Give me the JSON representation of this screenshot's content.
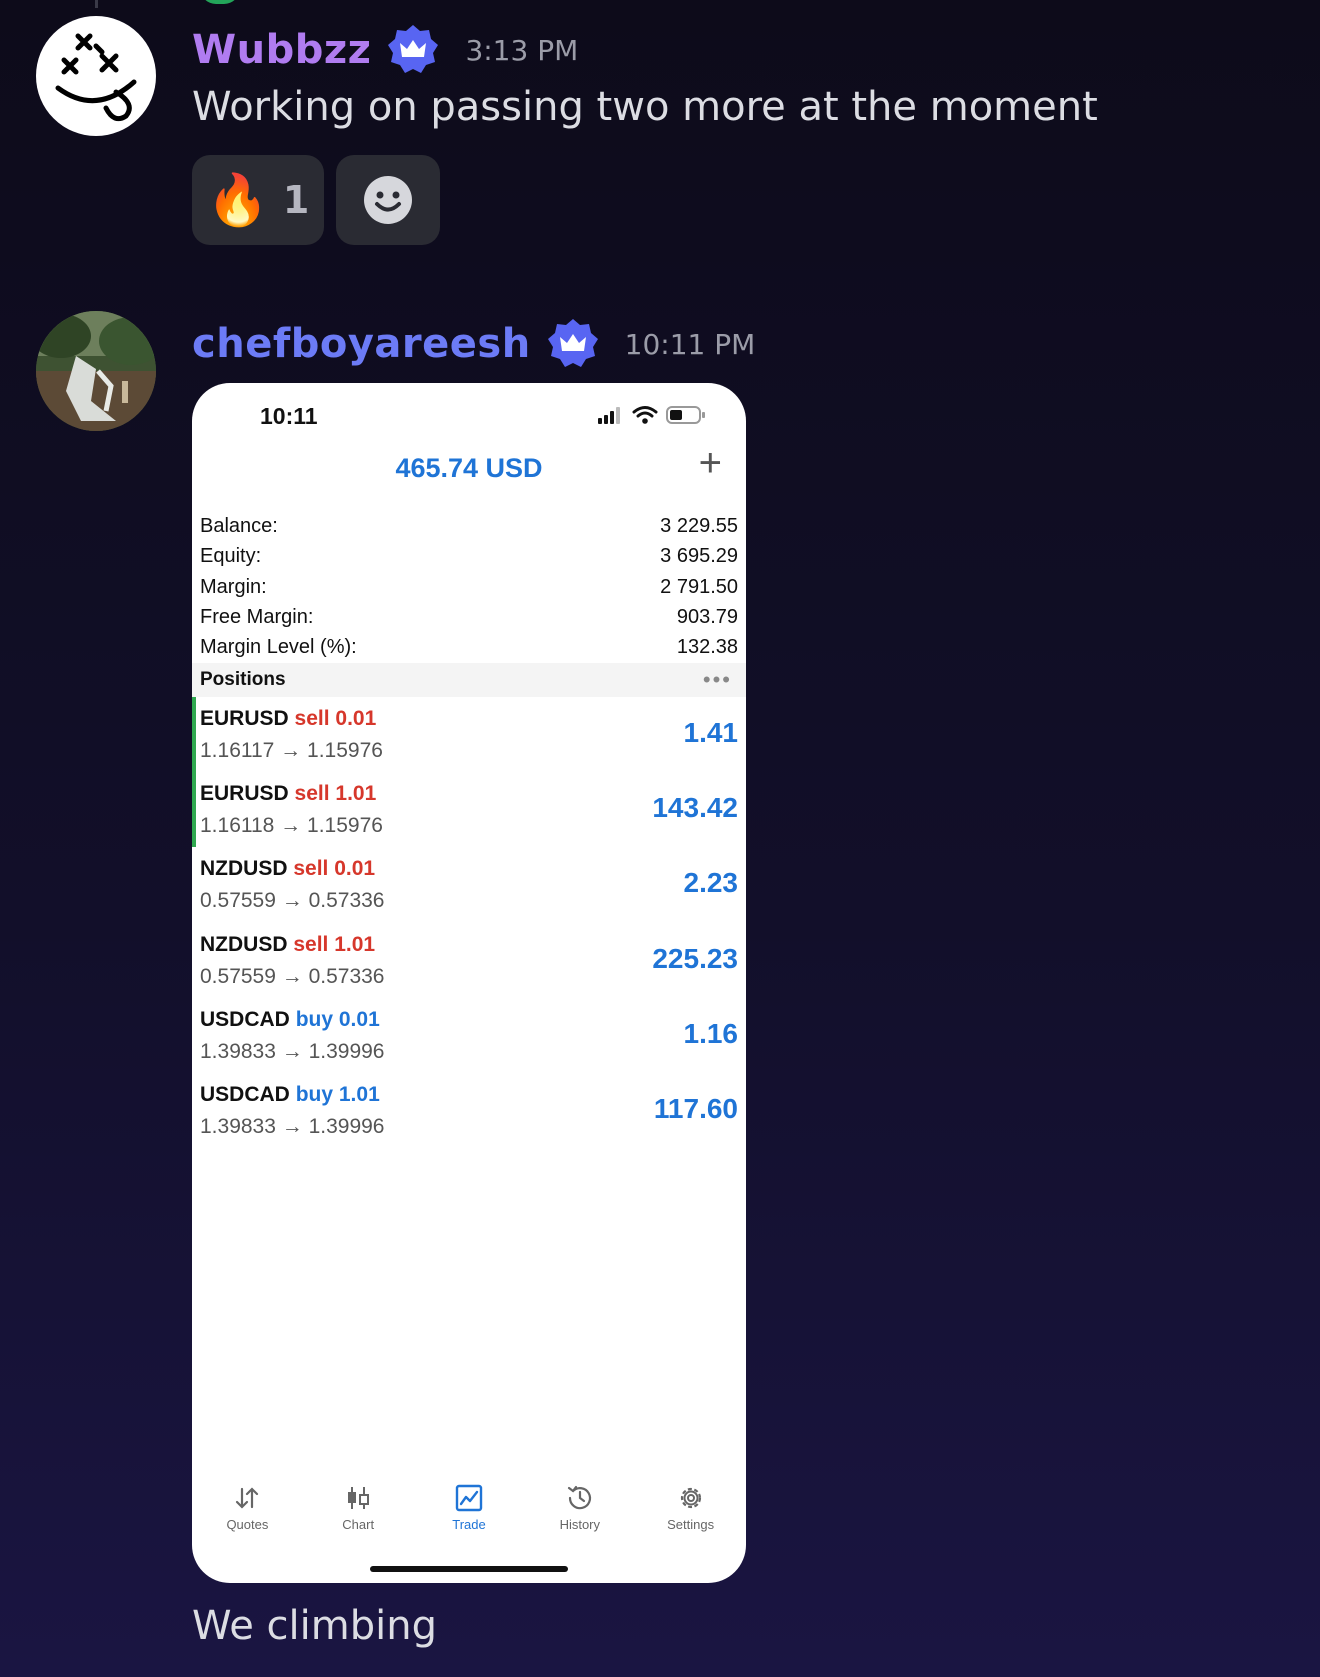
{
  "colors": {
    "wubbzz_name": "#b07cf0",
    "chef_name": "#6c7bf6",
    "badge": "#5865f2",
    "trade_blue": "#1f74d6",
    "sell_red": "#d6372b",
    "open_marker_green": "#2fa84f"
  },
  "messages": [
    {
      "username": "Wubbzz",
      "badge_icon": "nitro-crown-badge-icon",
      "timestamp": "3:13 PM",
      "text": "Working on passing two more at the moment",
      "reactions": [
        {
          "emoji": "🔥",
          "count": "1"
        }
      ]
    },
    {
      "username": "chefboyareesh",
      "badge_icon": "nitro-crown-badge-icon",
      "timestamp": "10:11 PM",
      "text": "We climbing"
    }
  ],
  "phone": {
    "status_time": "10:11",
    "header_value": "465.74 USD",
    "plus_label": "+",
    "summary": [
      {
        "label": "Balance:",
        "value": "3 229.55"
      },
      {
        "label": "Equity:",
        "value": "3 695.29"
      },
      {
        "label": "Margin:",
        "value": "2 791.50"
      },
      {
        "label": "Free Margin:",
        "value": "903.79"
      },
      {
        "label": "Margin Level (%):",
        "value": "132.38"
      }
    ],
    "positions_title": "Positions",
    "more_label": "•••",
    "positions": [
      {
        "symbol": "EURUSD",
        "side": "sell",
        "volume": "0.01",
        "prices": "1.16117 → 1.15976",
        "profit": "1.41"
      },
      {
        "symbol": "EURUSD",
        "side": "sell",
        "volume": "1.01",
        "prices": "1.16118 → 1.15976",
        "profit": "143.42"
      },
      {
        "symbol": "NZDUSD",
        "side": "sell",
        "volume": "0.01",
        "prices": "0.57559 → 0.57336",
        "profit": "2.23"
      },
      {
        "symbol": "NZDUSD",
        "side": "sell",
        "volume": "1.01",
        "prices": "0.57559 → 0.57336",
        "profit": "225.23"
      },
      {
        "symbol": "USDCAD",
        "side": "buy",
        "volume": "0.01",
        "prices": "1.39833 → 1.39996",
        "profit": "1.16"
      },
      {
        "symbol": "USDCAD",
        "side": "buy",
        "volume": "1.01",
        "prices": "1.39833 → 1.39996",
        "profit": "117.60"
      }
    ],
    "tabs": [
      {
        "label": "Quotes",
        "icon": "quotes-arrows-icon"
      },
      {
        "label": "Chart",
        "icon": "candlestick-chart-icon"
      },
      {
        "label": "Trade",
        "icon": "trade-chart-icon",
        "active": true
      },
      {
        "label": "History",
        "icon": "history-clock-icon"
      },
      {
        "label": "Settings",
        "icon": "settings-gear-icon"
      }
    ]
  }
}
